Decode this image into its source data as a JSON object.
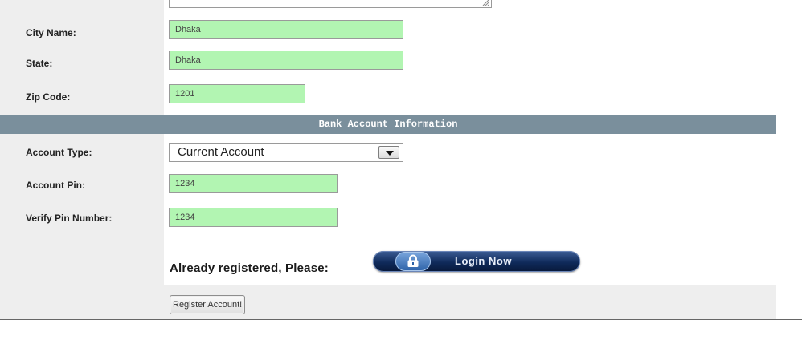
{
  "address": {
    "city_label": "City Name:",
    "city_value": "Dhaka",
    "state_label": "State:",
    "state_value": "Dhaka",
    "zip_label": "Zip Code:",
    "zip_value": "1201"
  },
  "bank_section": {
    "title": "Bank Account Information",
    "account_type_label": "Account Type:",
    "account_type_value": "Current Account",
    "account_pin_label": "Account Pin:",
    "account_pin_value": "1234",
    "verify_pin_label": "Verify Pin Number:",
    "verify_pin_value": "1234"
  },
  "login_prompt": {
    "text": "Already registered, Please:",
    "button_label": "Login Now",
    "icon": "lock-icon"
  },
  "register_button": {
    "label": "Register Account!"
  },
  "colors": {
    "field_bg": "#b2f5b2",
    "section_bar": "#7a8f9c",
    "label_column": "#eeeeee",
    "login_button": "#0f2a5a"
  }
}
